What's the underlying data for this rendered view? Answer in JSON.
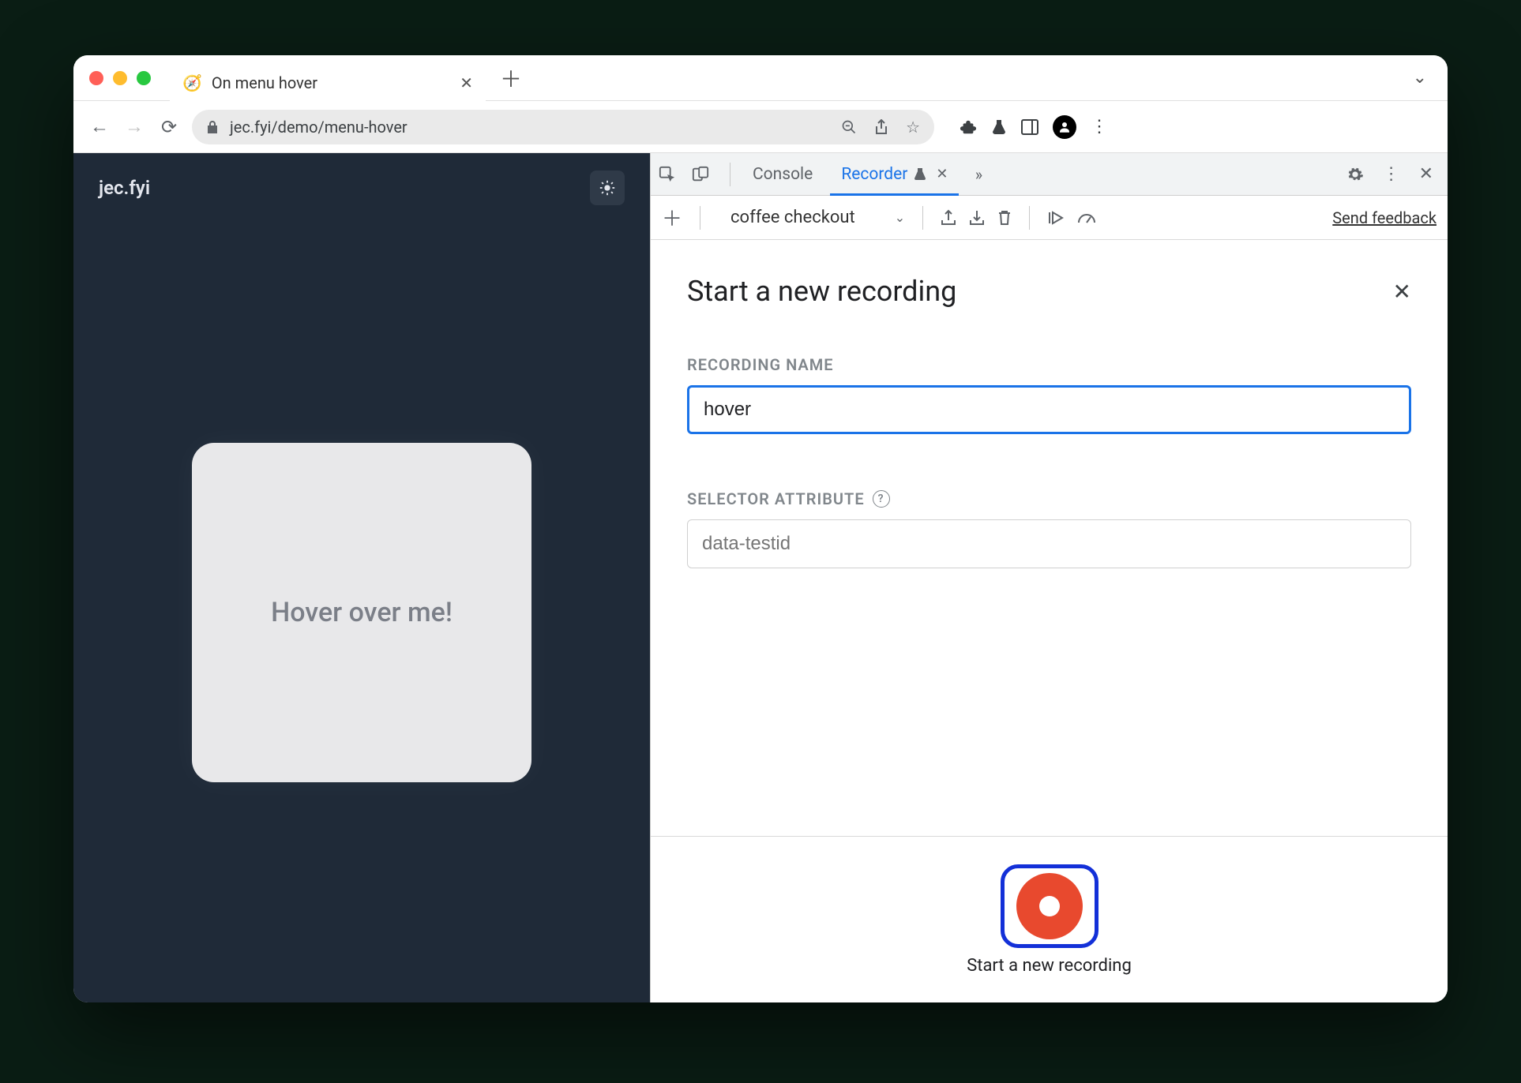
{
  "browser": {
    "tab_title": "On menu hover",
    "url": "jec.fyi/demo/menu-hover"
  },
  "page": {
    "site_title": "jec.fyi",
    "hover_card_text": "Hover over me!"
  },
  "devtools": {
    "tabs": {
      "console": "Console",
      "recorder": "Recorder"
    },
    "toolbar": {
      "recording_dropdown": "coffee checkout",
      "feedback": "Send feedback"
    },
    "panel": {
      "title": "Start a new recording",
      "recording_name_label": "RECORDING NAME",
      "recording_name_value": "hover",
      "selector_label": "SELECTOR ATTRIBUTE",
      "selector_placeholder": "data-testid",
      "record_button_label": "Start a new recording"
    }
  }
}
